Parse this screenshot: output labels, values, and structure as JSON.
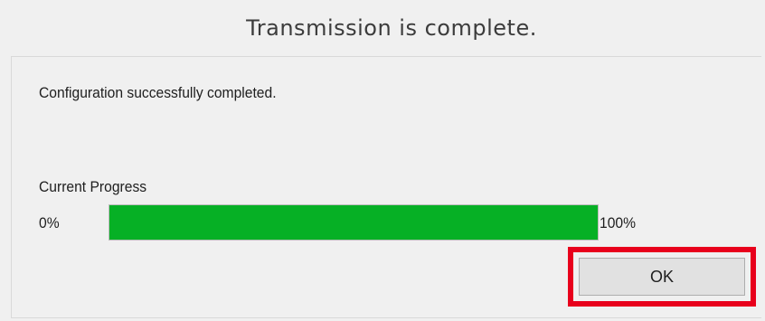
{
  "dialog": {
    "title": "Transmission is complete.",
    "message": "Configuration successfully completed.",
    "progress": {
      "label": "Current Progress",
      "min_label": "0%",
      "max_label": "100%",
      "value_percent": 100,
      "fill_color": "#06b025"
    },
    "ok_label": "OK",
    "highlight_color": "#e8001c"
  }
}
